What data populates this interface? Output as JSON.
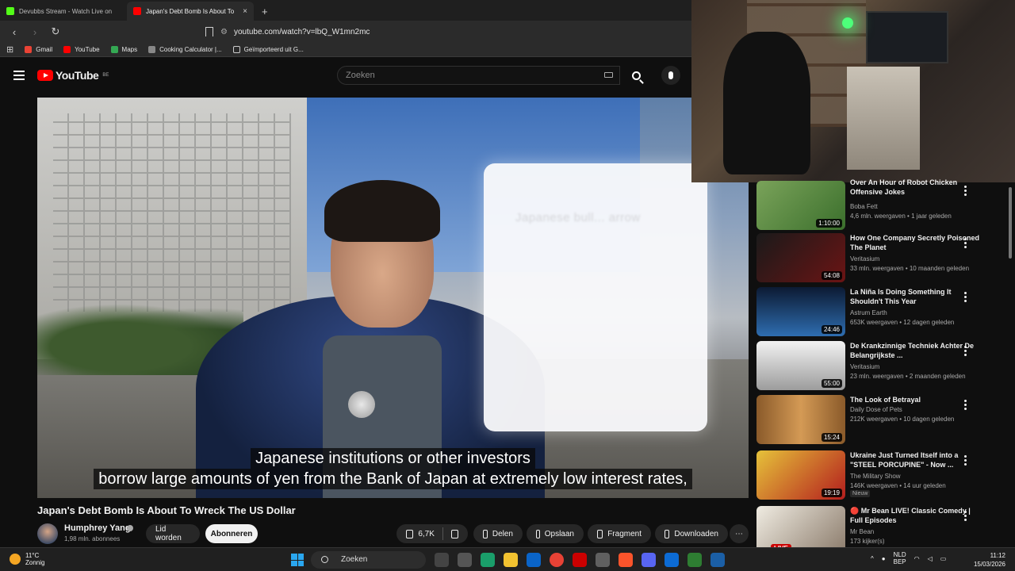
{
  "browser": {
    "tabs": [
      {
        "title": "Devubbs Stream - Watch Live on",
        "favicon_color": "#53fc18",
        "active": false
      },
      {
        "title": "Japan's Debt Bomb Is About To",
        "favicon_color": "#ff0000",
        "active": true
      }
    ],
    "new_tab": "+",
    "close": "×",
    "url": "youtube.com/watch?v=lbQ_W1mn2mc",
    "bookmarks": [
      {
        "label": "Gmail",
        "color": "#ea4335"
      },
      {
        "label": "YouTube",
        "color": "#ff0000"
      },
      {
        "label": "Maps",
        "color": "#34a853"
      },
      {
        "label": "Cooking Calculator |...",
        "color": "#888888"
      },
      {
        "label": "Geïmporteerd uit G...",
        "color": "#f1c232"
      }
    ]
  },
  "youtube": {
    "logo_text": "YouTube",
    "logo_region": "BE",
    "search_placeholder": "Zoeken"
  },
  "video": {
    "overlay_text": "Japanese bull... arrow",
    "caption_lines": [
      "Japanese institutions or other investors",
      "borrow large amounts of yen from the Bank of Japan at extremely low interest rates,"
    ],
    "title": "Japan's Debt Bomb Is About To Wreck The US Dollar",
    "channel": "Humphrey Yang",
    "subscribers": "1,98 mln. abonnees",
    "join_label": "Lid worden",
    "subscribe_label": "Abonneren",
    "likes": "6,7K",
    "share_label": "Delen",
    "save_label": "Opslaan",
    "clip_label": "Fragment",
    "download_label": "Downloaden",
    "more": "⋯"
  },
  "recommendations": [
    {
      "title": "Over An Hour of Robot Chicken Offensive Jokes",
      "channel": "Boba Fett",
      "meta": "4,6 mln. weergaven • 1 jaar geleden",
      "duration": "1:10:00",
      "thumb": "#3b6f2c"
    },
    {
      "title": "How One Company Secretly Poisoned The Planet",
      "channel": "Veritasium",
      "meta": "33 mln. weergaven • 10 maanden geleden",
      "duration": "54:08",
      "thumb": "#6b1414"
    },
    {
      "title": "La Niña Is Doing Something It Shouldn't This Year",
      "channel": "Astrum Earth",
      "meta": "653K weergaven • 12 dagen geleden",
      "duration": "24:46",
      "thumb": "#1b3f73"
    },
    {
      "title": "De Krankzinnige Techniek Achter De Belangrijkste ...",
      "channel": "Veritasium",
      "meta": "23 mln. weergaven • 2 maanden geleden",
      "duration": "55:00",
      "thumb": "#d9d9d9"
    },
    {
      "title": "The Look of Betrayal",
      "channel": "Daily Dose of Pets",
      "meta": "212K weergaven • 10 dagen geleden",
      "duration": "15:24",
      "thumb": "#a8692d"
    },
    {
      "title": "Ukraine Just Turned Itself into a \"STEEL PORCUPINE\" - Now ...",
      "channel": "The Military Show",
      "meta": "146K weergaven • 14 uur geleden",
      "duration": "19:19",
      "badge": "Nieuw",
      "thumb": "#b31d1d"
    },
    {
      "title": "🔴 Mr Bean LIVE! Classic Comedy | Full Episodes",
      "channel": "Mr Bean",
      "meta": "173 kijker(s)",
      "live": "LIVE",
      "thumb": "#ddd8cc"
    }
  ],
  "taskbar": {
    "temperature": "11°C",
    "weather": "Zonnig",
    "search": "Zoeken",
    "lang_top": "NLD",
    "lang_bottom": "BEP",
    "time": "11:12",
    "date": "15/03/2026",
    "tray_up": "^"
  }
}
